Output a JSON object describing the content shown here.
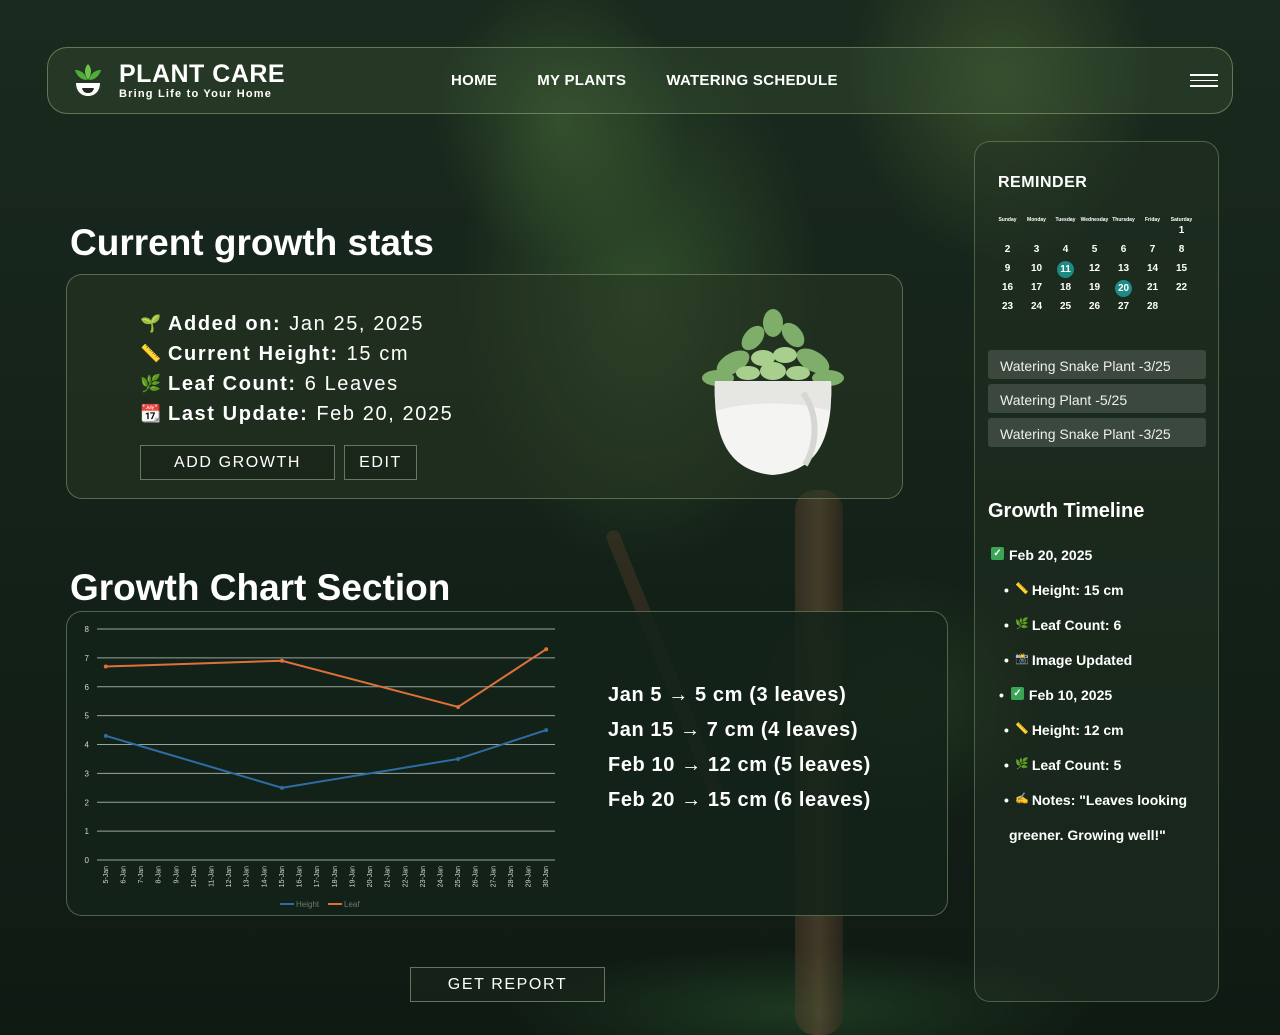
{
  "header": {
    "brand_title": "PLANT CARE",
    "brand_tagline": "Bring Life to Your Home",
    "nav": [
      "HOME",
      "MY PLANTS",
      "WATERING SCHEDULE"
    ]
  },
  "stats": {
    "heading": "Current growth stats",
    "rows": [
      {
        "emoji": "🌱",
        "label": "Added on:",
        "value": "Jan 25, 2025"
      },
      {
        "emoji": "📏",
        "label": "Current Height:",
        "value": "15 cm"
      },
      {
        "emoji": "🌿",
        "label": "Leaf Count:",
        "value": "6 Leaves"
      },
      {
        "emoji": "📆",
        "label": "Last Update:",
        "value": "Feb 20, 2025"
      }
    ],
    "add_growth": "ADD GROWTH",
    "edit": "EDIT"
  },
  "chart_section": {
    "heading": "Growth Chart Section",
    "notes": [
      "Jan 5 → 5 cm (3 leaves)",
      "Jan 15 → 7 cm (4 leaves)",
      "Feb 10 → 12 cm (5 leaves)",
      "Feb 20 → 15 cm (6 leaves)"
    ]
  },
  "chart_data": {
    "type": "line",
    "categories": [
      "5-Jan",
      "6-Jan",
      "7-Jan",
      "8-Jan",
      "9-Jan",
      "10-Jan",
      "11-Jan",
      "12-Jan",
      "13-Jan",
      "14-Jan",
      "15-Jan",
      "16-Jan",
      "17-Jan",
      "18-Jan",
      "19-Jan",
      "20-Jan",
      "21-Jan",
      "22-Jan",
      "23-Jan",
      "24-Jan",
      "25-Jan",
      "26-Jan",
      "27-Jan",
      "28-Jan",
      "29-Jan",
      "30-Jan"
    ],
    "y_ticks": [
      0,
      1,
      2,
      3,
      4,
      5,
      6,
      7,
      8
    ],
    "ylim": [
      0,
      8
    ],
    "grid": true,
    "legend_position": "bottom",
    "series": [
      {
        "name": "Height",
        "color": "#2e6da4",
        "points": [
          {
            "x": "5-Jan",
            "y": 4.3
          },
          {
            "x": "15-Jan",
            "y": 2.5
          },
          {
            "x": "25-Jan",
            "y": 3.5
          },
          {
            "x": "30-Jan",
            "y": 4.5
          }
        ]
      },
      {
        "name": "Leaf",
        "color": "#e0703a",
        "points": [
          {
            "x": "5-Jan",
            "y": 6.7
          },
          {
            "x": "15-Jan",
            "y": 6.9
          },
          {
            "x": "25-Jan",
            "y": 5.3
          },
          {
            "x": "30-Jan",
            "y": 7.3
          }
        ]
      }
    ]
  },
  "report_button": "GET REPORT",
  "sidebar": {
    "reminder_title": "REMINDER",
    "weekdays": [
      "Sunday",
      "Monday",
      "Tuesday",
      "Wednesday",
      "Thursday",
      "Friday",
      "Saturday"
    ],
    "weeks": [
      [
        "",
        "",
        "",
        "",
        "",
        "",
        "1"
      ],
      [
        "2",
        "3",
        "4",
        "5",
        "6",
        "7",
        "8"
      ],
      [
        "9",
        "10",
        "11",
        "12",
        "13",
        "14",
        "15"
      ],
      [
        "16",
        "17",
        "18",
        "19",
        "20",
        "21",
        "22"
      ],
      [
        "23",
        "24",
        "25",
        "26",
        "27",
        "28",
        ""
      ]
    ],
    "highlighted_days": [
      "11",
      "20"
    ],
    "highlight_color": "#1d8a84",
    "reminders": [
      "Watering Snake Plant -3/25",
      "Watering Plant -5/25",
      "Watering Snake Plant -3/25"
    ],
    "timeline_title": "Growth Timeline",
    "timeline": [
      {
        "type": "date",
        "text": "Feb 20, 2025",
        "bullet": false
      },
      {
        "type": "item",
        "emoji": "📏",
        "text": "Height: 15 cm"
      },
      {
        "type": "item",
        "emoji": "🌿",
        "text": "Leaf Count: 6"
      },
      {
        "type": "item",
        "emoji": "📸",
        "text": "Image Updated"
      },
      {
        "type": "date",
        "text": "Feb 10, 2025",
        "bullet": true
      },
      {
        "type": "item",
        "emoji": "📏",
        "text": "Height: 12 cm"
      },
      {
        "type": "item",
        "emoji": "🌿",
        "text": "Leaf Count: 5"
      },
      {
        "type": "item",
        "emoji": "✍",
        "text": "Notes: \"Leaves looking"
      },
      {
        "type": "cont",
        "text": "greener. Growing well!\""
      }
    ]
  }
}
